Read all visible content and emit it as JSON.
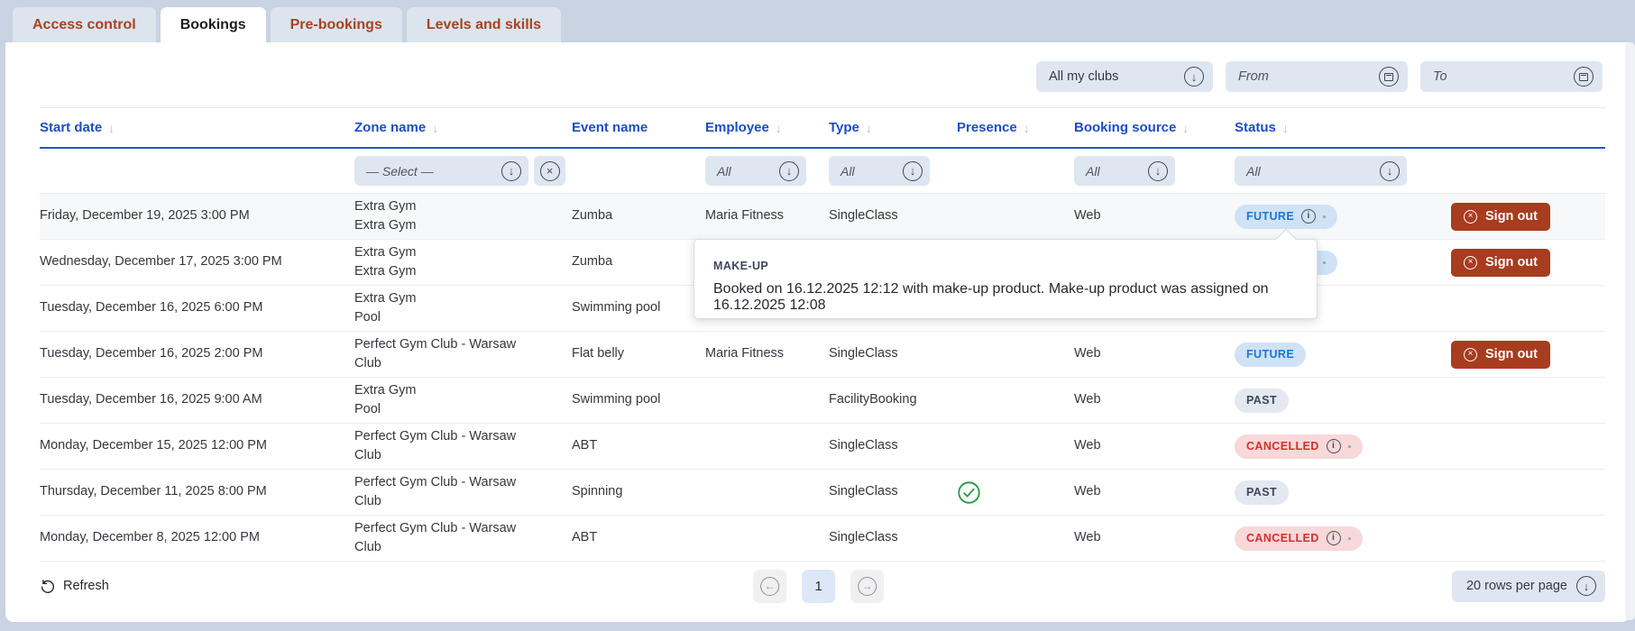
{
  "tabs": [
    {
      "label": "Access control",
      "active": false
    },
    {
      "label": "Bookings",
      "active": true
    },
    {
      "label": "Pre-bookings",
      "active": false
    },
    {
      "label": "Levels and skills",
      "active": false
    }
  ],
  "top_filters": {
    "clubs": "All my clubs",
    "from_placeholder": "From",
    "to_placeholder": "To"
  },
  "table": {
    "columns": [
      {
        "label": "Start date",
        "sortable": true
      },
      {
        "label": "Zone name",
        "sortable": true
      },
      {
        "label": "Event name",
        "sortable": false
      },
      {
        "label": "Employee",
        "sortable": true
      },
      {
        "label": "Type",
        "sortable": true
      },
      {
        "label": "Presence",
        "sortable": true
      },
      {
        "label": "Booking source",
        "sortable": true
      },
      {
        "label": "Status",
        "sortable": true
      }
    ],
    "filters": {
      "zone": "— Select —",
      "employee": "All",
      "type": "All",
      "booking_source": "All",
      "status": "All"
    },
    "rows": [
      {
        "date": "Friday, December 19, 2025 3:00 PM",
        "zone1": "Extra Gym",
        "zone2": "Extra Gym",
        "event": "Zumba",
        "employee": "Maria Fitness",
        "type": "SingleClass",
        "source": "Web",
        "status": "FUTURE"
      },
      {
        "date": "Wednesday, December 17, 2025 3:00 PM",
        "zone1": "Extra Gym",
        "zone2": "Extra Gym",
        "event": "Zumba",
        "employee": "",
        "type": "",
        "source": "",
        "status": "FUTURE"
      },
      {
        "date": "Tuesday, December 16, 2025 6:00 PM",
        "zone1": "Extra Gym",
        "zone2": "Pool",
        "event": "Swimming pool",
        "employee": "",
        "type": "",
        "source": "",
        "status": ""
      },
      {
        "date": "Tuesday, December 16, 2025 2:00 PM",
        "zone1": "Perfect Gym Club - Warsaw",
        "zone2": "Club",
        "event": "Flat belly",
        "employee": "Maria Fitness",
        "type": "SingleClass",
        "source": "Web",
        "status": "FUTURE"
      },
      {
        "date": "Tuesday, December 16, 2025 9:00 AM",
        "zone1": "Extra Gym",
        "zone2": "Pool",
        "event": "Swimming pool",
        "employee": "",
        "type": "FacilityBooking",
        "source": "Web",
        "status": "PAST"
      },
      {
        "date": "Monday, December 15, 2025 12:00 PM",
        "zone1": "Perfect Gym Club - Warsaw",
        "zone2": "Club",
        "event": "ABT",
        "employee": "",
        "type": "SingleClass",
        "source": "Web",
        "status": "CANCELLED"
      },
      {
        "date": "Thursday, December 11, 2025 8:00 PM",
        "zone1": "Perfect Gym Club - Warsaw",
        "zone2": "Club",
        "event": "Spinning",
        "employee": "",
        "type": "SingleClass",
        "source": "Web",
        "status": "PAST"
      },
      {
        "date": "Monday, December 8, 2025 12:00 PM",
        "zone1": "Perfect Gym Club - Warsaw",
        "zone2": "Club",
        "event": "ABT",
        "employee": "",
        "type": "SingleClass",
        "source": "Web",
        "status": "CANCELLED"
      }
    ]
  },
  "tooltip": {
    "title": "MAKE-UP",
    "body": "Booked on 16.12.2025 12:12 with make-up product. Make-up product was assigned on 16.12.2025 12:08"
  },
  "actions": {
    "sign_out": "Sign out",
    "refresh": "Refresh"
  },
  "footer": {
    "page": "1",
    "rows_per_page": "20 rows per page"
  },
  "colors": {
    "accent_blue": "#1d4dc4",
    "brand_rust": "#a7431f",
    "signout_red": "#a83c1e",
    "future_blue": "#1878d4",
    "cancelled_red": "#d32f2f",
    "past_navy": "#3c465c",
    "presence_green": "#2b9e4a"
  }
}
